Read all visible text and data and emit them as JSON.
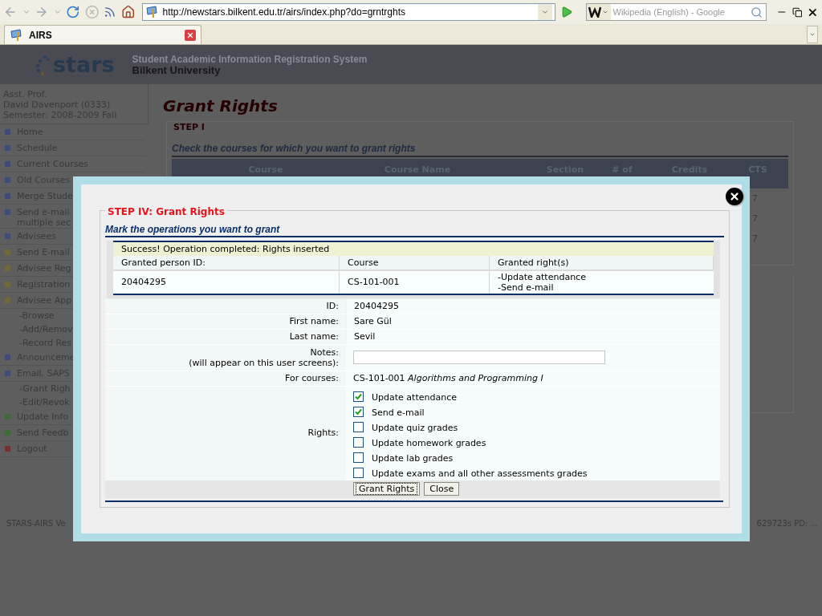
{
  "browser": {
    "url": "http://newstars.bilkent.edu.tr/airs/index.php?do=grntrghts",
    "search": {
      "placeholder": "Wikipedia (English) - Google"
    },
    "tabs": [
      {
        "label": "AIRS",
        "selected": true
      }
    ]
  },
  "header": {
    "logo": "stars",
    "title": "Student Academic Information Registration System",
    "subtitle": "Bilkent University"
  },
  "user": {
    "lines": [
      "Asst. Prof.",
      "David Davenport (0333)",
      "Semester: 2008-2009 Fall"
    ]
  },
  "menu": [
    {
      "kind": "item",
      "label": "Home",
      "color": "#3e4a78"
    },
    {
      "kind": "item",
      "label": "Schedule",
      "color": "#3e4a78"
    },
    {
      "kind": "item",
      "label": "Current Courses",
      "color": "#3e4a78"
    },
    {
      "kind": "item",
      "label": "Old Courses",
      "color": "#3e4a78"
    },
    {
      "kind": "item",
      "label": "Merge Stude",
      "color": "#3e4a78"
    },
    {
      "kind": "item",
      "label": "Send e-mail",
      "label2": "multiple sec",
      "color": "#3e4a78"
    },
    {
      "kind": "item",
      "label": "Advisees",
      "color": "#3e4a78"
    },
    {
      "kind": "item",
      "label": "Send E-mail",
      "color": "#72683a"
    },
    {
      "kind": "item",
      "label": "Advisee Reg",
      "color": "#72683a"
    },
    {
      "kind": "item",
      "label": "Registration",
      "color": "#72683a"
    },
    {
      "kind": "item",
      "label": "Advisee App",
      "color": "#72683a"
    },
    {
      "kind": "sub",
      "label": "-Browse"
    },
    {
      "kind": "sub",
      "label": "-Add/Remov"
    },
    {
      "kind": "sub",
      "label": "-Record Res"
    },
    {
      "kind": "item",
      "label": "Announceme",
      "color": "#3e4a78"
    },
    {
      "kind": "item",
      "label": "Email, SAPS",
      "color": "#3e4a78"
    },
    {
      "kind": "sub",
      "label": "-Grant Righ"
    },
    {
      "kind": "sub",
      "label": "-Edit/Revok"
    },
    {
      "kind": "item",
      "label": "Update Info",
      "color": "#3f6a36"
    },
    {
      "kind": "item",
      "label": "Send Feedb",
      "color": "#3f6a36"
    },
    {
      "kind": "item",
      "label": "Logout",
      "color": "#733232"
    }
  ],
  "page": {
    "title": "Grant Rights",
    "step": "STEP I",
    "instruction": "Check the courses for which you want to grant rights",
    "columns": [
      "Course",
      "Course Name",
      "Section",
      "# of",
      "Credits",
      "CTS"
    ],
    "cells": [
      "7",
      "7",
      "7"
    ]
  },
  "footer": {
    "left": "STARS-AIRS Ve",
    "right": "629723s PD: ..."
  },
  "dialog": {
    "legend": "STEP IV: Grant Rights",
    "heading": "Mark the operations you want to grant",
    "result": {
      "message": "Success! Operation completed: Rights inserted",
      "columns": [
        "Granted person ID:",
        "Course",
        "Granted right(s)"
      ],
      "row": {
        "person_id": "20404295",
        "course": "CS-101-001",
        "rights": [
          "-Update attendance",
          "-Send e-mail"
        ]
      }
    },
    "fields": [
      {
        "label": "ID:",
        "value": "20404295"
      },
      {
        "label": "First name:",
        "value": "Sare Gül"
      },
      {
        "label": "Last name:",
        "value": "Sevil"
      }
    ],
    "notes": {
      "label": "Notes:",
      "hint": "(will appear on this user screens):"
    },
    "courses": {
      "label": "For courses:",
      "code": "CS-101-001",
      "name": "Algorithms and Programming I"
    },
    "rights_label": "Rights:",
    "rights": [
      {
        "label": "Update attendance",
        "checked": true
      },
      {
        "label": "Send e-mail",
        "checked": true
      },
      {
        "label": "Update quiz grades",
        "checked": false
      },
      {
        "label": "Update homework grades",
        "checked": false
      },
      {
        "label": "Update lab grades",
        "checked": false
      },
      {
        "label": "Update exams and all other assessments grades",
        "checked": false
      }
    ],
    "buttons": [
      {
        "label": "Grant Rights",
        "focused": true
      },
      {
        "label": "Close",
        "focused": false
      }
    ]
  }
}
